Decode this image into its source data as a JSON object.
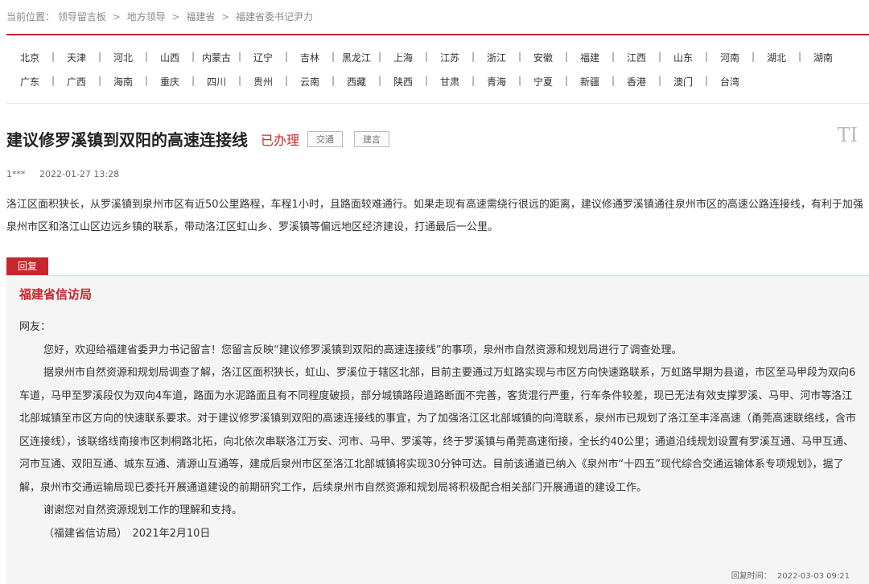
{
  "breadcrumb": {
    "label": "当前位置：",
    "items": [
      "领导留言板",
      "地方领导",
      "福建省",
      "福建省委书记尹力"
    ],
    "separator": ">"
  },
  "regions": {
    "row1": [
      "北京",
      "天津",
      "河北",
      "山西",
      "内蒙古",
      "辽宁",
      "吉林",
      "黑龙江",
      "上海",
      "江苏",
      "浙江",
      "安徽",
      "福建",
      "江西",
      "山东",
      "河南",
      "湖北",
      "湖南"
    ],
    "row2": [
      "广东",
      "广西",
      "海南",
      "重庆",
      "四川",
      "贵州",
      "云南",
      "西藏",
      "陕西",
      "甘肃",
      "青海",
      "宁夏",
      "新疆",
      "香港",
      "澳门",
      "台湾"
    ]
  },
  "post": {
    "title": "建议修罗溪镇到双阳的高速连接线",
    "status": "已办理",
    "tags": [
      "交通",
      "建言"
    ],
    "font_toggle": "TI",
    "author": "1***",
    "time": "2022-01-27 13:28",
    "content": "洛江区面积狭长，从罗溪镇到泉州市区有近50公里路程，车程1小时，且路面较难通行。如果走现有高速需绕行很远的距离，建议修通罗溪镇通往泉州市区的高速公路连接线，有利于加强泉州市区和洛江山区边远乡镇的联系，带动洛江区虹山乡、罗溪镇等偏远地区经济建设，打通最后一公里。"
  },
  "reply": {
    "badge": "回复",
    "org": "福建省信访局",
    "greeting": "网友：",
    "paragraphs": [
      "您好，欢迎给福建省委尹力书记留言！您留言反映“建议修罗溪镇到双阳的高速连接线”的事项，泉州市自然资源和规划局进行了调查处理。",
      "据泉州市自然资源和规划局调查了解，洛江区面积狭长，虹山、罗溪位于辖区北部，目前主要通过万虹路实现与市区方向快速路联系，万虹路早期为县道，市区至马甲段为双向6车道，马甲至罗溪段仅为双向4车道，路面为水泥路面且有不同程度破损，部分城镇路段道路断面不完善，客货混行严重，行车条件较差，现已无法有效支撑罗溪、马甲、河市等洛江北部城镇至市区方向的快速联系要求。对于建议修罗溪镇到双阳的高速连接线的事宜，为了加强洛江区北部城镇的向湾联系，泉州市已规划了洛江至丰泽高速（甬莞高速联络线，含市区连接线），该联络线南接市区刺桐路北拓，向北依次串联洛江万安、河市、马甲、罗溪等，终于罗溪镇与甬莞高速衔接，全长约40公里；通道沿线规划设置有罗溪互通、马甲互通、河市互通、双阳互通、城东互通、清源山互通等，建成后泉州市区至洛江北部城镇将实现30分钟可达。目前该通道已纳入《泉州市“十四五”现代综合交通运输体系专项规划》，据了解，泉州市交通运输局现已委托开展通道建设的前期研究工作，后续泉州市自然资源和规划局将积极配合相关部门开展通道的建设工作。",
      "谢谢您对自然资源规划工作的理解和支持。",
      "（福建省信访局）　2021年2月10日"
    ],
    "time_label": "回复时间：",
    "time": "2022-03-03 09:21"
  }
}
